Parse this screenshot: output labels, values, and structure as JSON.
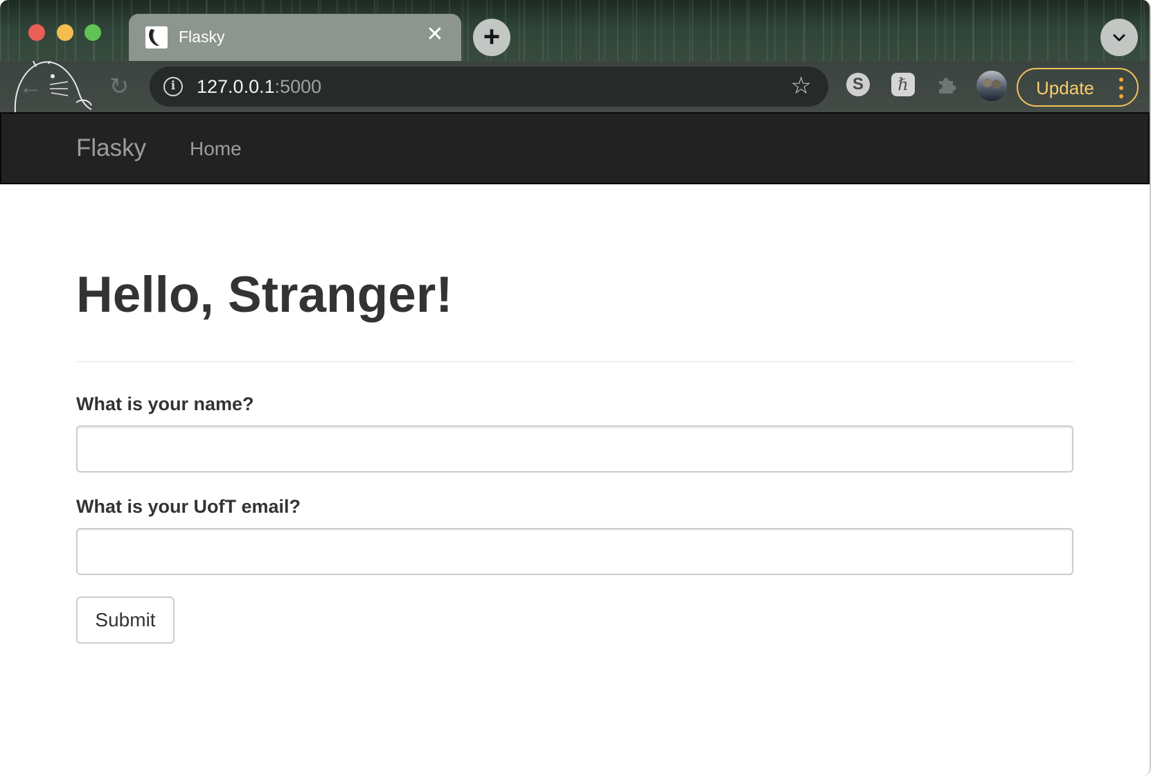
{
  "browser": {
    "tab": {
      "title": "Flasky",
      "close_glyph": "✕"
    },
    "new_tab_glyph": "+",
    "toolbar": {
      "back_glyph": "←",
      "reload_glyph": "↻",
      "url_host": "127.0.0.1",
      "url_port": ":5000",
      "info_glyph": "i",
      "star_glyph": "☆",
      "extensions": {
        "skype_glyph": "S",
        "h_glyph": "ℏ"
      },
      "update_label": "Update"
    }
  },
  "navbar": {
    "brand": "Flasky",
    "links": [
      "Home"
    ]
  },
  "main": {
    "title": "Hello, Stranger!",
    "form": {
      "name_label": "What is your name?",
      "name_value": "",
      "email_label": "What is your UofT email?",
      "email_value": "",
      "submit_label": "Submit"
    }
  },
  "colors": {
    "navbar_bg": "#222222",
    "navbar_text": "#9d9d9d",
    "heading_text": "#333333",
    "update_accent": "#f6cd6c"
  },
  "icons": [
    "close-icon",
    "plus-icon",
    "chevron-down-icon",
    "back-arrow-icon",
    "reload-icon",
    "info-icon",
    "star-icon",
    "skype-icon",
    "hatena-icon",
    "puzzle-icon"
  ]
}
